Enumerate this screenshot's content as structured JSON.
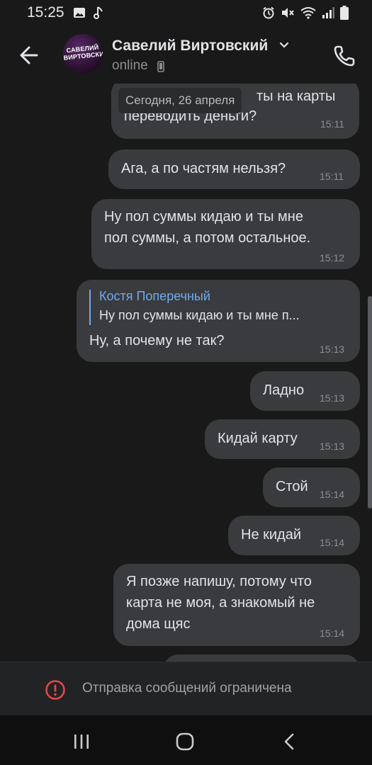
{
  "status_bar": {
    "time": "15:25",
    "left_icons": [
      "image-icon",
      "music-note-icon"
    ],
    "right_icons": [
      "alarm-icon",
      "mute-icon",
      "wifi-icon",
      "signal-icon",
      "battery-icon"
    ]
  },
  "header": {
    "back_icon": "arrow-left-icon",
    "avatar_text": "САВЕЛИЙ ВИРТОВСКИЙ",
    "contact_name": "Савелий Виртовский",
    "status": "online",
    "call_icon": "phone-icon"
  },
  "chat": {
    "date_chip": "Сегодня, 26 апреля",
    "messages": [
      {
        "lines": [
          "ты на карты",
          "переводить деньги?"
        ],
        "time": "15:11"
      },
      {
        "lines": [
          "Ага, а по частям нельзя?"
        ],
        "time": "15:11"
      },
      {
        "lines": [
          "Ну пол суммы кидаю и ты мне",
          "пол суммы, а потом остальное."
        ],
        "time": "15:12"
      },
      {
        "reply": {
          "author": "Костя Поперечный",
          "text": "Ну пол суммы кидаю и ты мне п..."
        },
        "lines": [
          "Ну, а почему не так?"
        ],
        "time": "15:13"
      },
      {
        "lines": [
          "Ладно"
        ],
        "time": "15:13"
      },
      {
        "lines": [
          "Кидай карту"
        ],
        "time": "15:13"
      },
      {
        "lines": [
          "Стой"
        ],
        "time": "15:14"
      },
      {
        "lines": [
          "Не кидай"
        ],
        "time": "15:14"
      },
      {
        "lines": [
          "Я позже напишу, потому что",
          "карта не моя, а знакомый не",
          "дома щяс"
        ],
        "time": "15:14"
      }
    ]
  },
  "restricted": {
    "icon": "warning-circle-icon",
    "text": "Отправка сообщений ограничена",
    "accent": "#e64646"
  },
  "nav": {
    "recent_icon": "recent-apps-icon",
    "home_icon": "home-icon",
    "back_icon": "nav-back-icon"
  }
}
